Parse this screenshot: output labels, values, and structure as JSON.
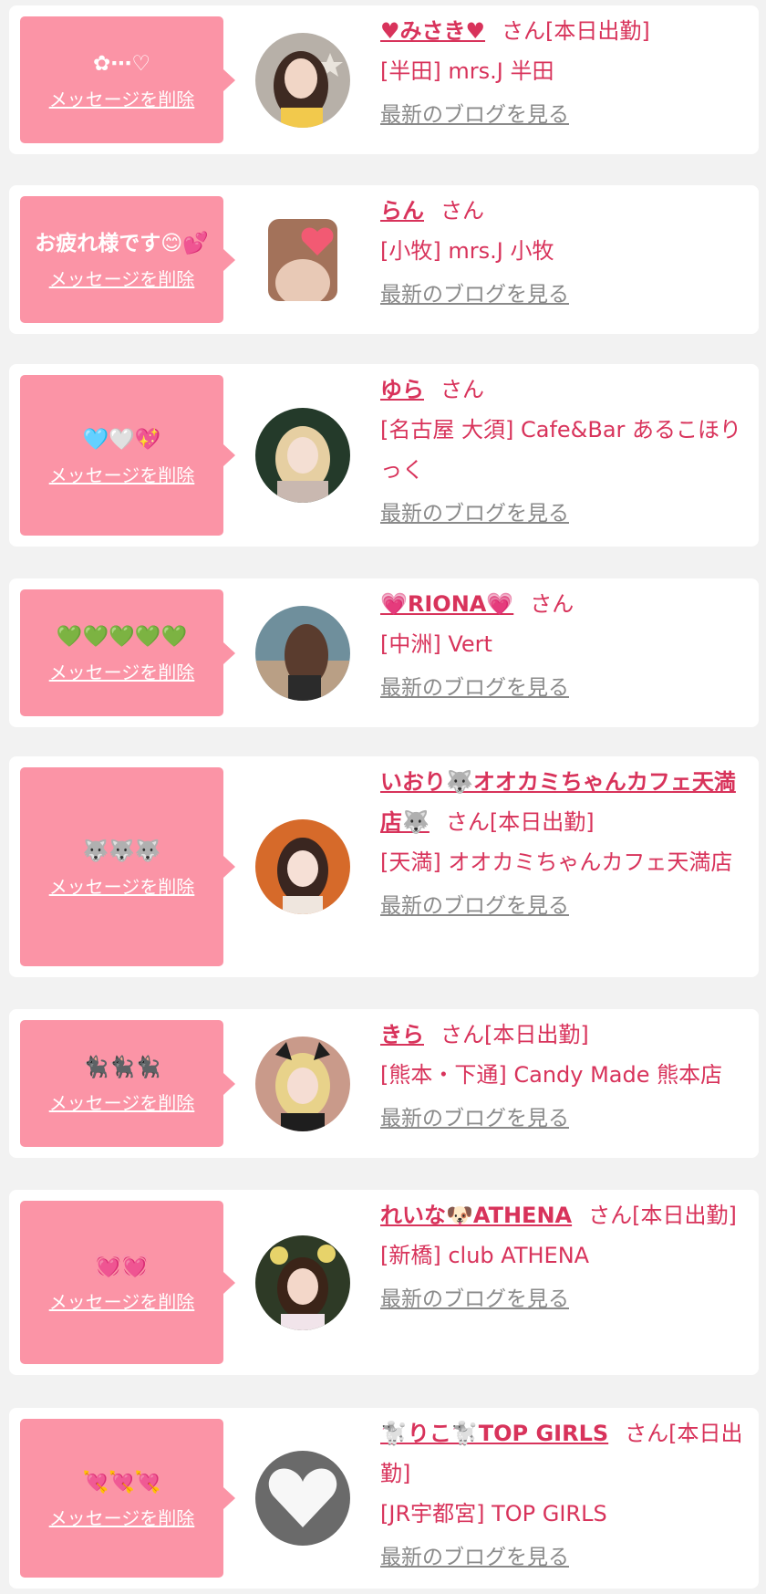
{
  "delete_label": "メッセージを削除",
  "san_label": "さん",
  "blog_label": "最新のブログを見る",
  "colors": {
    "accent": "#d8335b",
    "bubble": "#fb94a6",
    "background": "#f2f2f2"
  },
  "cards": [
    {
      "message": "✿⋯♡",
      "name": "♥みさき♥",
      "status": "[本日出勤]",
      "shop": "[半田] mrs.J 半田",
      "avatar_icon": "girl-photo-icon"
    },
    {
      "message": "お疲れ様です😊💕",
      "name": "らん",
      "status": "",
      "shop": "[小牧] mrs.J 小牧",
      "avatar_icon": "heart-covered-photo-icon"
    },
    {
      "message": "🩵🤍💖",
      "name": "ゆら",
      "status": "",
      "shop": "[名古屋 大須] Cafe&Bar あるこほりっく",
      "avatar_icon": "girl-photo-icon"
    },
    {
      "message": "💚💚💚💚💚",
      "name": "💗RIONA💗",
      "status": "",
      "shop": "[中洲] Vert",
      "avatar_icon": "girl-photo-icon"
    },
    {
      "message": "🐺🐺🐺",
      "name": "いおり🐺オオカミちゃんカフェ天満店🐺",
      "status": "[本日出勤]",
      "shop": "[天満] オオカミちゃんカフェ天満店",
      "avatar_icon": "girl-photo-icon"
    },
    {
      "message": "🐈‍⬛🐈‍⬛🐈‍⬛",
      "name": "きら",
      "status": "[本日出勤]",
      "shop": "[熊本・下通] Candy Made 熊本店",
      "avatar_icon": "girl-photo-icon"
    },
    {
      "message": "💓💓",
      "name": "れいな🐶ATHENA",
      "status": "[本日出勤]",
      "shop": "[新橋] club ATHENA",
      "avatar_icon": "girl-photo-icon"
    },
    {
      "message": "💘💘💘",
      "name": "🐩りこ🐩TOP GIRLS",
      "status": "[本日出勤]",
      "shop": "[JR宇都宮] TOP GIRLS",
      "avatar_icon": "white-heart-icon"
    }
  ]
}
